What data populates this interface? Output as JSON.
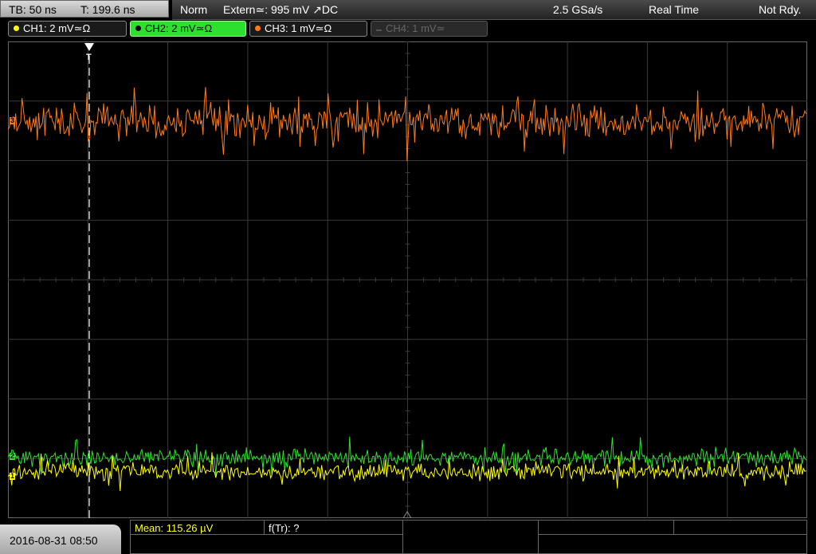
{
  "header": {
    "timebase": "TB: 50 ns",
    "trigger_time": "T: 199.6 ns",
    "mode": "Norm",
    "trigger_source": "Extern≃: 995 mV ↗DC",
    "sample_rate": "2.5 GSa/s",
    "acq_mode": "Real Time",
    "status": "Not Rdy."
  },
  "channels": [
    {
      "label": "CH1: 2 mV≃Ω",
      "color": "#ffff00",
      "state": "on"
    },
    {
      "label": "CH2: 2 mV≃Ω",
      "color": "#2ee02e",
      "state": "selected"
    },
    {
      "label": "CH3: 1 mV≃Ω",
      "color": "#ff7a1a",
      "state": "on"
    },
    {
      "label": "CH4: 1 mV≃",
      "color": "#666666",
      "state": "off"
    }
  ],
  "markers": {
    "ch3": "3",
    "ch2": "2",
    "ch1": "1",
    "trigger": "T"
  },
  "footer": {
    "datetime": "2016-08-31 08:50",
    "mean": "Mean: 115.26 µV",
    "freq": "f(Tr): ?"
  },
  "colors": {
    "ch1": "#ffff00",
    "ch2": "#2ee02e",
    "ch3": "#ff7a1a",
    "grid": "#3a3a3a"
  }
}
